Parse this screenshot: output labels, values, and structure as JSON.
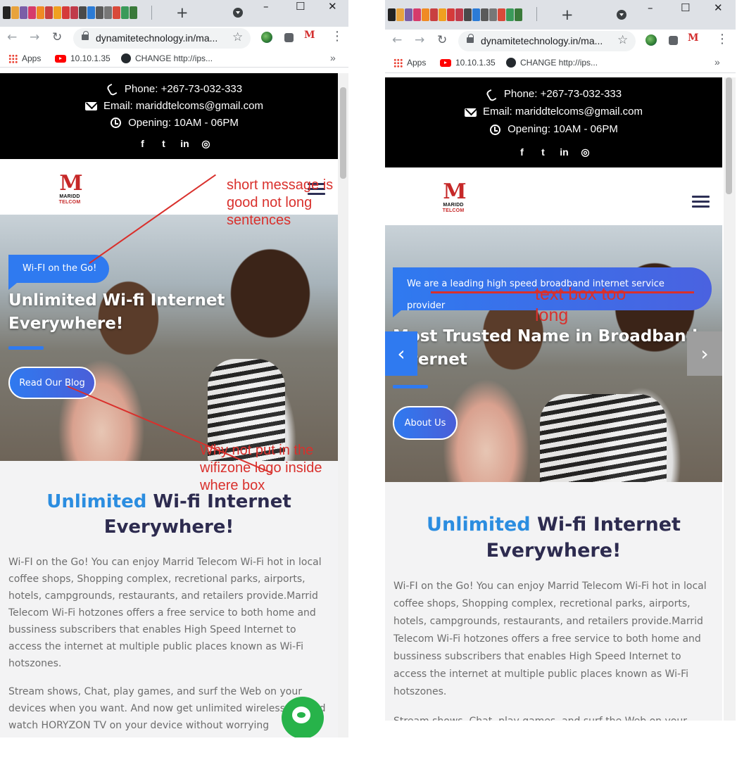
{
  "browser": {
    "url": "dynamitetechnology.in/ma...",
    "bookmarks": [
      {
        "label": "Apps"
      },
      {
        "label": "10.10.1.35"
      },
      {
        "label": "CHANGE http://ips..."
      }
    ],
    "new_tab": "+",
    "bookmarks_more": "»",
    "minimize": "–",
    "maximize": "☐",
    "close": "✕",
    "back": "←",
    "forward": "→",
    "reload": "↻",
    "star": "☆",
    "menu": "⋮"
  },
  "site": {
    "phone": "Phone: +267-73-032-333",
    "email": "Email: mariddtelcoms@gmail.com",
    "opening": "Opening: 10AM - 06PM",
    "socials": [
      "f",
      "t",
      "in",
      "◎"
    ],
    "logo_mark": "M",
    "logo_text_1": "MARIDD",
    "logo_text_2": "TELCOM",
    "headline_accent": "Unlimited",
    "headline_rest": " Wi-fi Internet Everywhere!",
    "para1": "Wi-FI on the Go! You can enjoy Marrid Telecom Wi-Fi hot in local coffee shops, Shopping complex, recretional parks, airports, hotels, campgrounds, restaurants, and retailers provide.Marrid Telecom Wi-Fi hotzones offers a free service to both home and bussiness subscribers that enables High Speed Internet to access the internet at multiple public places known as Wi-Fi hotszones.",
    "para2_left": "Stream shows, Chat, play games, and surf the Web on your devices when you want. And now get unlimited wireless d... and watch HORYZON TV on your device without worrying",
    "para2_right": "Stream shows, Chat, play games, and surf the Web on your"
  },
  "left_slide": {
    "pill": "Wi-FI on the Go!",
    "title": "Unlimited Wi-fi Internet Everywhere!",
    "button": "Read Our Blog"
  },
  "right_slide": {
    "pill": "We are a leading high speed broadband internet service provider",
    "title": "Most Trusted Name in Broadband Internet",
    "button": "About Us",
    "prev": "‹",
    "next": "›"
  },
  "annotations": {
    "a1": "short message is good not long sentences",
    "a2": "Why not put in the wifizone logo inside where box",
    "a3": "text box too long"
  },
  "colors": {
    "accent": "#2f7af0",
    "headline_dark": "#2d2b4f",
    "headline_blue": "#2b8de0",
    "annotation_red": "#d9302c",
    "chat_green": "#27b34a"
  }
}
